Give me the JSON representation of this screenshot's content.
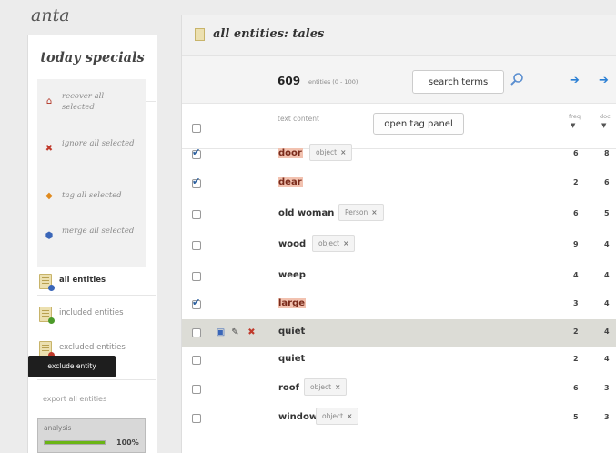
{
  "app": {
    "logo_text": "anta"
  },
  "sidebar": {
    "title": "today specials",
    "specials": [
      {
        "label": "recover all selected",
        "icon": "recover-icon",
        "color": "#b03020"
      },
      {
        "label": "ignore all selected",
        "icon": "ignore-icon",
        "color": "#c0392b"
      },
      {
        "label": "tag all selected",
        "icon": "tag-icon",
        "color": "#e08a1e"
      },
      {
        "label": "merge all selected",
        "icon": "merge-icon",
        "color": "#3a66b8"
      }
    ],
    "nav": [
      {
        "label": "all entities",
        "active": true
      },
      {
        "label": "included entities",
        "active": false
      },
      {
        "label": "excluded entities",
        "active": false
      }
    ],
    "export_label": "export all entities",
    "analysis": {
      "label": "analysis",
      "progress": 1.0,
      "progress_text": "100%"
    }
  },
  "main": {
    "title": "all entities: tales",
    "count": "609",
    "count_sub": "entities (0 - 100)",
    "search_value": "search terms",
    "columns": {
      "text": "text content",
      "open_tag_panel": "open tag panel",
      "freq": "freq",
      "doc": "doc"
    },
    "rows": [
      {
        "term": "door",
        "highlighted": true,
        "checked": true,
        "tag": "object",
        "freq": "6",
        "doc": "8"
      },
      {
        "term": "dear",
        "highlighted": true,
        "checked": true,
        "tag": "",
        "freq": "2",
        "doc": "6"
      },
      {
        "term": "old woman",
        "highlighted": false,
        "checked": false,
        "tag": "Person",
        "freq": "6",
        "doc": "5"
      },
      {
        "term": "wood",
        "highlighted": false,
        "checked": false,
        "tag": "object",
        "freq": "9",
        "doc": "4"
      },
      {
        "term": "weep",
        "highlighted": false,
        "checked": false,
        "tag": "",
        "freq": "4",
        "doc": "4"
      },
      {
        "term": "large",
        "highlighted": true,
        "checked": true,
        "tag": "",
        "freq": "3",
        "doc": "4"
      },
      {
        "term": "quiet",
        "highlighted": false,
        "checked": false,
        "tag": "",
        "freq": "2",
        "doc": "4",
        "hovered": true
      },
      {
        "term": "quiet",
        "highlighted": false,
        "checked": false,
        "tag": "",
        "freq": "2",
        "doc": "4"
      },
      {
        "term": "roof",
        "highlighted": false,
        "checked": false,
        "tag": "object",
        "freq": "6",
        "doc": "3"
      },
      {
        "term": "window",
        "highlighted": false,
        "checked": false,
        "tag": "object",
        "freq": "5",
        "doc": "3"
      }
    ],
    "tooltip": "exclude entity",
    "accent_color": "#2a7fd4",
    "highlight_color": "#f2c2b0"
  }
}
